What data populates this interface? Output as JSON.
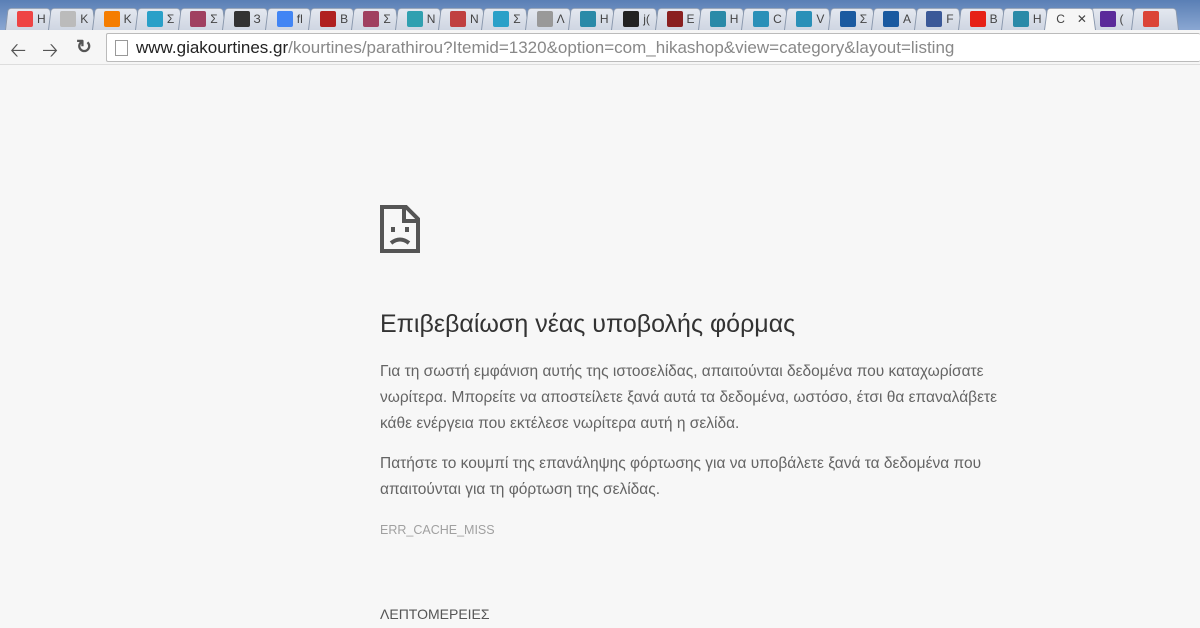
{
  "tabs": [
    {
      "letter": "H",
      "icon": "joomla-icon",
      "color": "#e44"
    },
    {
      "letter": "K",
      "icon": "page-icon",
      "color": "#bbb"
    },
    {
      "letter": "K",
      "icon": "blogger-icon",
      "color": "#f57d00"
    },
    {
      "letter": "Σ",
      "icon": "home-icon",
      "color": "#2aa0c8"
    },
    {
      "letter": "Σ",
      "icon": "curtain-icon",
      "color": "#a04060"
    },
    {
      "letter": "З",
      "icon": "hat-icon",
      "color": "#333"
    },
    {
      "letter": "fl",
      "icon": "google-icon",
      "color": "#4285f4"
    },
    {
      "letter": "B",
      "icon": "chef-icon",
      "color": "#b02020"
    },
    {
      "letter": "Σ",
      "icon": "curtain-icon",
      "color": "#a04060"
    },
    {
      "letter": "N",
      "icon": "k-logo-icon",
      "color": "#30a0b0"
    },
    {
      "letter": "N",
      "icon": "saray-icon",
      "color": "#c04040"
    },
    {
      "letter": "Σ",
      "icon": "home-icon",
      "color": "#2aa0c8"
    },
    {
      "letter": "Λ",
      "icon": "cart-icon",
      "color": "#999"
    },
    {
      "letter": "H",
      "icon": "hikashop-icon",
      "color": "#2a8aa8"
    },
    {
      "letter": "j(",
      "icon": "github-icon",
      "color": "#222"
    },
    {
      "letter": "E",
      "icon": "grid-icon",
      "color": "#8a2020"
    },
    {
      "letter": "H",
      "icon": "hikashop-icon",
      "color": "#2a8aa8"
    },
    {
      "letter": "C",
      "icon": "s5-icon",
      "color": "#2a90b8"
    },
    {
      "letter": "V",
      "icon": "s5-icon",
      "color": "#2a90b8"
    },
    {
      "letter": "Σ",
      "icon": "s-logo-icon",
      "color": "#1a5aa0"
    },
    {
      "letter": "A",
      "icon": "s-logo-icon",
      "color": "#1a5aa0"
    },
    {
      "letter": "F",
      "icon": "facebook-icon",
      "color": "#3b5998"
    },
    {
      "letter": "B",
      "icon": "youtube-icon",
      "color": "#e62117"
    },
    {
      "letter": "H",
      "icon": "hikashop-icon",
      "color": "#2a8aa8"
    },
    {
      "letter": "C",
      "icon": "none",
      "color": "",
      "active": true
    },
    {
      "letter": "(",
      "icon": "mail-icon",
      "color": "#5a2a9a"
    },
    {
      "letter": "",
      "icon": "chrome-icon",
      "color": "#db4437"
    }
  ],
  "toolbar": {
    "url_host": "www.giakourtines.gr",
    "url_path": "/kourtines/parathirou?Itemid=1320&option=com_hikashop&view=category&layout=listing"
  },
  "error": {
    "title": "Επιβεβαίωση νέας υποβολής φόρμας",
    "para1": "Για τη σωστή εμφάνιση αυτής της ιστοσελίδας, απαιτούνται δεδομένα που καταχωρίσατε νωρίτερα. Μπορείτε να αποστείλετε ξανά αυτά τα δεδομένα, ωστόσο, έτσι θα επαναλάβετε κάθε ενέργεια που εκτέλεσε νωρίτερα αυτή η σελίδα.",
    "para2": "Πατήστε το κουμπί της επανάληψης φόρτωσης για να υποβάλετε ξανά τα δεδομένα που απαιτούνται για τη φόρτωση της σελίδας.",
    "code": "ERR_CACHE_MISS",
    "details": "ΛΕΠΤΟΜΕΡΕΙΕΣ"
  }
}
